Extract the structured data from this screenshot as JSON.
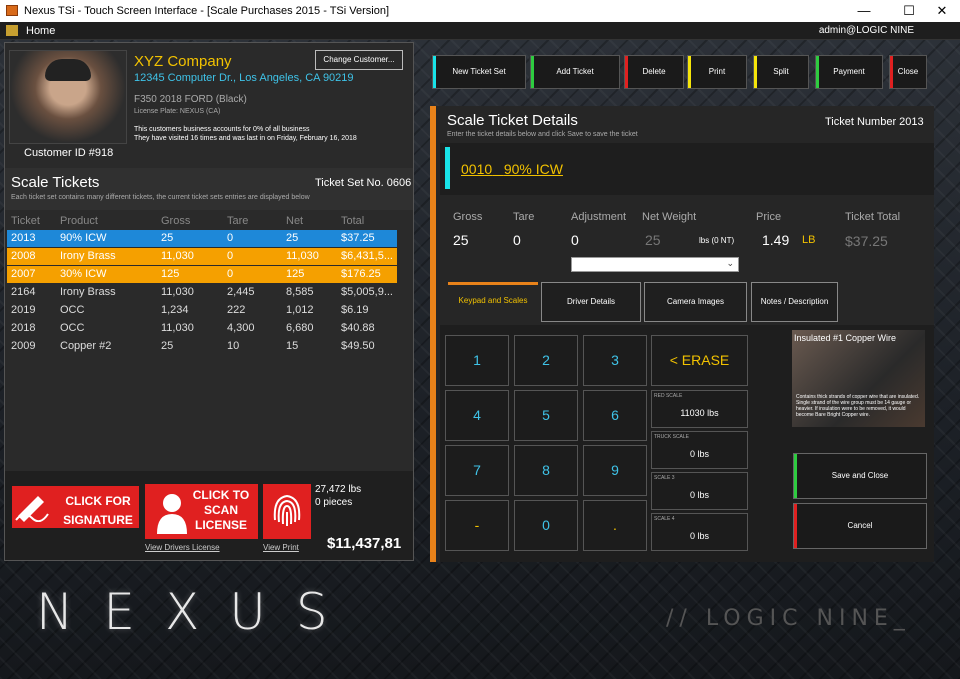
{
  "window": {
    "title": "Nexus TSi - Touch Screen Interface - [Scale Purchases 2015 - TSi Version]",
    "minimize": "—",
    "maximize": "☐",
    "close": "✕"
  },
  "menu": {
    "home": "Home",
    "user": "admin@LOGIC NINE"
  },
  "customer": {
    "company": "XYZ Company",
    "address": "12345 Computer Dr., Los Angeles, CA 90219",
    "vehicle": "F350 2018 FORD (Black)",
    "plate": "License Plate: NEXUS (CA)",
    "business_line1": "This customers business accounts for 0% of all business",
    "business_line2": "They have visited 16 times and was last in on Friday, February 16, 2018",
    "customer_id": "Customer ID #918",
    "change_button": "Change Customer..."
  },
  "tickets": {
    "title": "Scale Tickets",
    "set_no": "Ticket Set No. 0606",
    "description": "Each ticket set contains many different tickets, the current ticket sets entries are displayed below",
    "columns": [
      "Ticket",
      "Product",
      "Gross",
      "Tare",
      "Net",
      "Total"
    ],
    "rows": [
      {
        "ticket": "2013",
        "product": "90% ICW",
        "gross": "25",
        "tare": "0",
        "net": "25",
        "total": "$37.25",
        "state": "selected"
      },
      {
        "ticket": "2008",
        "product": "Irony Brass",
        "gross": "11,030",
        "tare": "0",
        "net": "11,030",
        "total": "$6,431,5...",
        "state": "highlight"
      },
      {
        "ticket": "2007",
        "product": "30% ICW",
        "gross": "125",
        "tare": "0",
        "net": "125",
        "total": "$176.25",
        "state": "highlight"
      },
      {
        "ticket": "2164",
        "product": "Irony Brass",
        "gross": "11,030",
        "tare": "2,445",
        "net": "8,585",
        "total": "$5,005,9...",
        "state": "normal"
      },
      {
        "ticket": "2019",
        "product": "OCC",
        "gross": "1,234",
        "tare": "222",
        "net": "1,012",
        "total": "$6.19",
        "state": "normal"
      },
      {
        "ticket": "2018",
        "product": "OCC",
        "gross": "11,030",
        "tare": "4,300",
        "net": "6,680",
        "total": "$40.88",
        "state": "normal"
      },
      {
        "ticket": "2009",
        "product": "Copper #2",
        "gross": "25",
        "tare": "10",
        "net": "15",
        "total": "$49.50",
        "state": "normal"
      }
    ]
  },
  "bottom": {
    "signature_label": "CLICK FOR SIGNATURE",
    "scan_label": "CLICK TO SCAN LICENSE",
    "view_license": "View Drivers License",
    "view_print": "View Print",
    "weight": "27,472 lbs",
    "pieces": "0 pieces",
    "total": "$11,437,81"
  },
  "toolbar": [
    {
      "label": "New Ticket Set",
      "color": "#19e3e8"
    },
    {
      "label": "Add Ticket",
      "color": "#2ecc40"
    },
    {
      "label": "Delete",
      "color": "#e02020"
    },
    {
      "label": "Print",
      "color": "#f5e50a"
    },
    {
      "label": "Split",
      "color": "#f5e50a"
    },
    {
      "label": "Payment",
      "color": "#2ecc40"
    },
    {
      "label": "Close",
      "color": "#e02020"
    }
  ],
  "details": {
    "title": "Scale Ticket Details",
    "description": "Enter the ticket details below and click Save to save the ticket",
    "ticket_number": "Ticket Number 2013",
    "product_code": "0010",
    "product_name": "90% ICW",
    "labels": {
      "gross": "Gross",
      "tare": "Tare",
      "adjustment": "Adjustment",
      "net_weight": "Net Weight",
      "price": "Price",
      "ticket_total": "Ticket Total"
    },
    "values": {
      "gross": "25",
      "tare": "0",
      "adjustment": "0",
      "net_weight": "25",
      "units": "lbs (0 NT)",
      "price": "1.49",
      "price_unit": "LB",
      "ticket_total": "$37.25"
    }
  },
  "tabs": [
    "Keypad and Scales",
    "Driver Details",
    "Camera Images",
    "Notes / Description"
  ],
  "keypad": {
    "keys": [
      "1",
      "2",
      "3",
      "4",
      "5",
      "6",
      "7",
      "8",
      "9",
      "-",
      "0",
      "."
    ],
    "erase": "< ERASE"
  },
  "scales": [
    {
      "label": "RED SCALE",
      "value": "11030 lbs"
    },
    {
      "label": "TRUCK SCALE",
      "value": "0 lbs"
    },
    {
      "label": "SCALE 3",
      "value": "0 lbs"
    },
    {
      "label": "SCALE 4",
      "value": "0 lbs"
    }
  ],
  "material": {
    "caption": "Insulated #1 Copper Wire",
    "description": "Contains thick strands of copper wire that are insulated. Single strand of the wire group must be 14 gauge or heavier. If insulation were to be removed, it would become Bare Bright Copper wire."
  },
  "actions": {
    "save": "Save and Close",
    "cancel": "Cancel",
    "save_color": "#2ecc40",
    "cancel_color": "#e02020"
  },
  "branding": {
    "nexus": "NEXUS",
    "logic": "// LOGIC NINE_"
  }
}
